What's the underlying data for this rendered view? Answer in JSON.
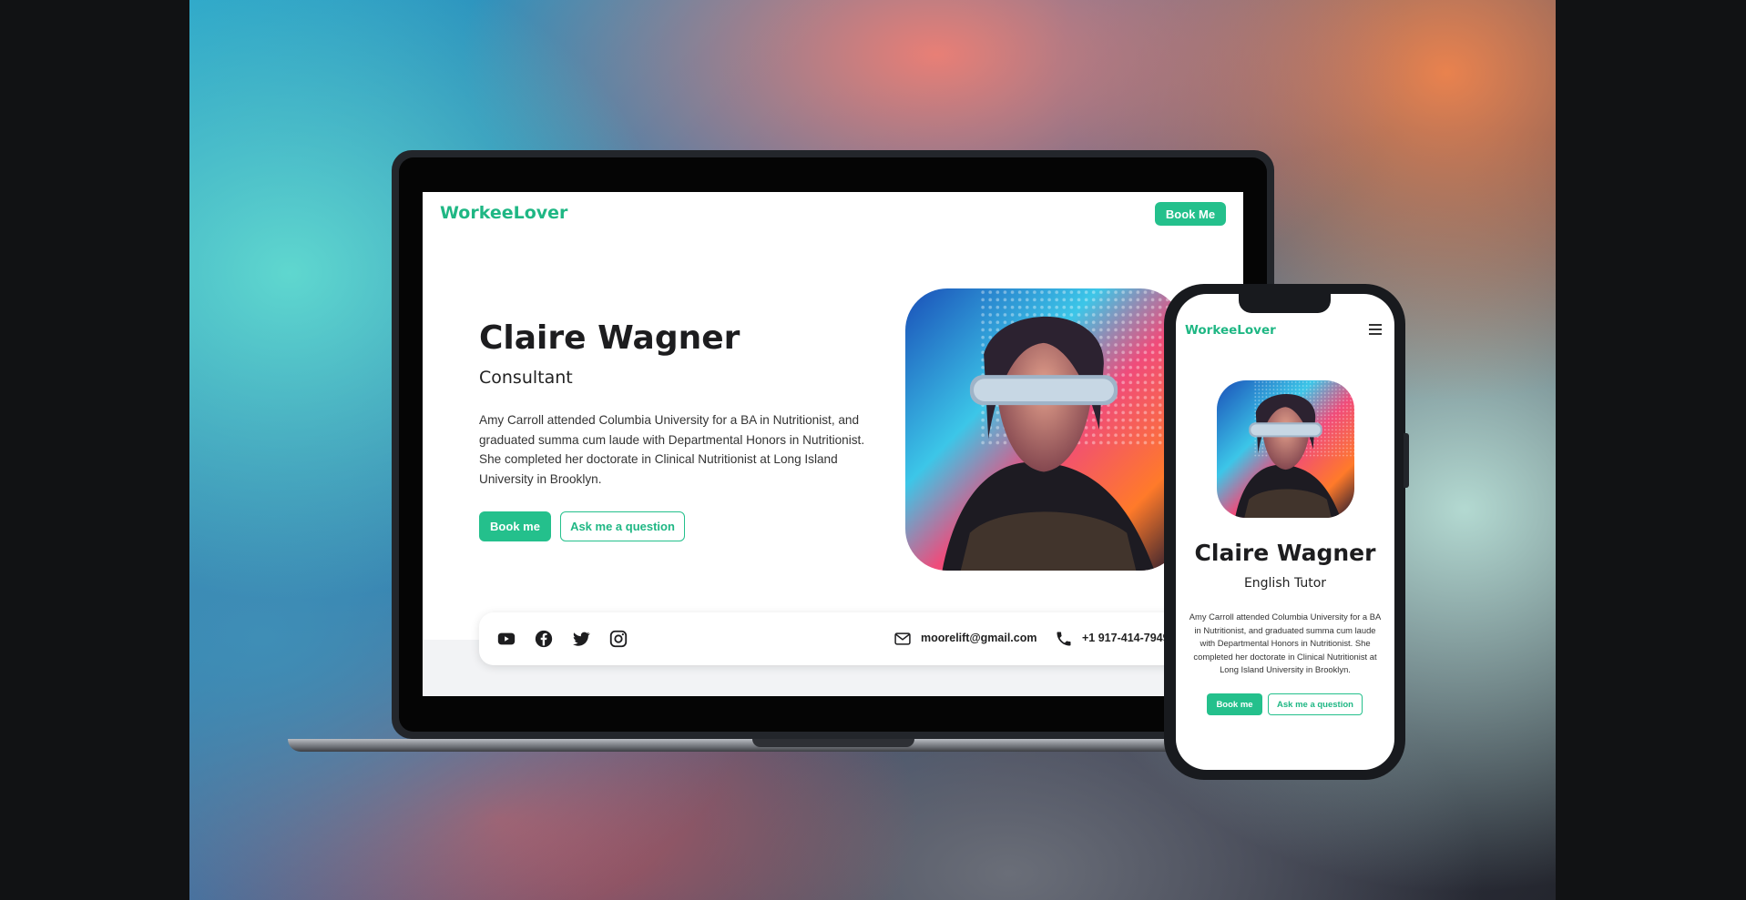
{
  "brand": {
    "name": "WorkeeLover",
    "accent": "#24c08c"
  },
  "desktop": {
    "header": {
      "book_label": "Book Me"
    },
    "profile": {
      "name": "Claire Wagner",
      "role": "Consultant",
      "bio": "Amy Carroll attended Columbia University for a BA in Nutritionist, and graduated summa cum laude with Departmental Honors in Nutritionist. She completed her doctorate in Clinical Nutritionist at Long Island University in Brooklyn.",
      "primary_button": "Book me",
      "secondary_button": "Ask me a question"
    },
    "contact": {
      "social": [
        "youtube-icon",
        "facebook-icon",
        "twitter-icon",
        "instagram-icon"
      ],
      "email": "moorelift@gmail.com",
      "phone": "+1 917-414-7949"
    }
  },
  "mobile": {
    "profile": {
      "name": "Claire Wagner",
      "role": "English Tutor",
      "bio": "Amy Carroll attended Columbia University for a BA in Nutritionist, and graduated summa cum laude with Departmental Honors in Nutritionist. She completed her doctorate in Clinical Nutritionist at Long Island University in Brooklyn.",
      "primary_button": "Book me",
      "secondary_button": "Ask me a question"
    }
  }
}
